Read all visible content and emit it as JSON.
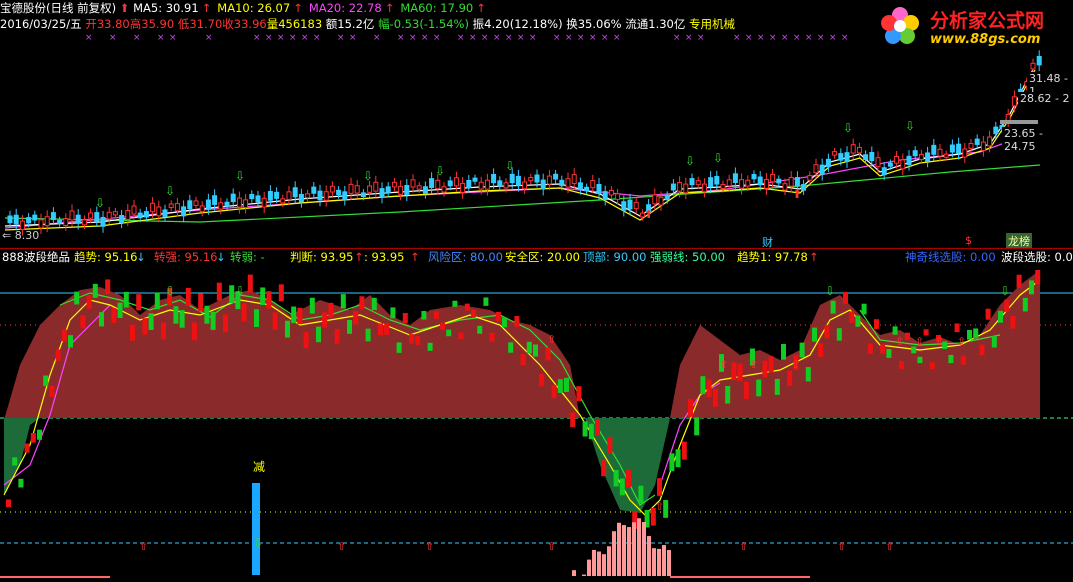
{
  "header": {
    "stock": "宝德股份(日线 前复权)",
    "ma": [
      {
        "label": "MA5: 30.91",
        "color": "#ffffff"
      },
      {
        "label": "MA10: 26.07",
        "color": "#ffff00"
      },
      {
        "label": "MA20: 22.78",
        "color": "#ff44ff"
      },
      {
        "label": "MA60: 17.90",
        "color": "#33dd33"
      }
    ],
    "date": "2016/03/25/五",
    "open": "开33.80",
    "high": "高35.90",
    "low": "低31.70",
    "close": "收33.96",
    "volume": "量456183",
    "amount": "额15.2亿",
    "change": "幅-0.53(-1.54%)",
    "amplitude": "振4.20(12.18%)",
    "turnover": "换35.06%",
    "float": "流通1.30亿",
    "sector": "专用机械"
  },
  "logo": {
    "title": "分析家公式网",
    "url": "www.88gs.com"
  },
  "price_axis": {
    "labels": [
      "31.48 - 1",
      "28.62 - 2",
      "23.65 - 24.75"
    ],
    "low_label": "8.30"
  },
  "markers": {
    "cai": "财",
    "dollar": "$",
    "longhu": "龙榜"
  },
  "indicator": {
    "name": "888波段绝品",
    "items": [
      {
        "label": "趋势: 95.16",
        "color": "#ffff00"
      },
      {
        "label": "转强: 95.16",
        "color": "#ff3333"
      },
      {
        "label": "转弱: -",
        "color": "#33dd33"
      },
      {
        "label": "判断: 93.95",
        "color": "#ffff00"
      },
      {
        "label": ": 93.95",
        "color": "#ffff00"
      },
      {
        "label": "风险区: 80.00",
        "color": "#4488ff"
      },
      {
        "label": "安全区: 20.00",
        "color": "#ffff00"
      },
      {
        "label": "顶部: 90.00",
        "color": "#33ccff"
      },
      {
        "label": "强弱线: 50.00",
        "color": "#33ff99"
      },
      {
        "label": "趋势1: 97.78",
        "color": "#ffff00"
      },
      {
        "label": "神奇线选股: 0.00",
        "color": "#3366ff"
      },
      {
        "label": "波段选股: 0.0",
        "color": "#ffffff"
      }
    ],
    "jian": "减"
  }
}
